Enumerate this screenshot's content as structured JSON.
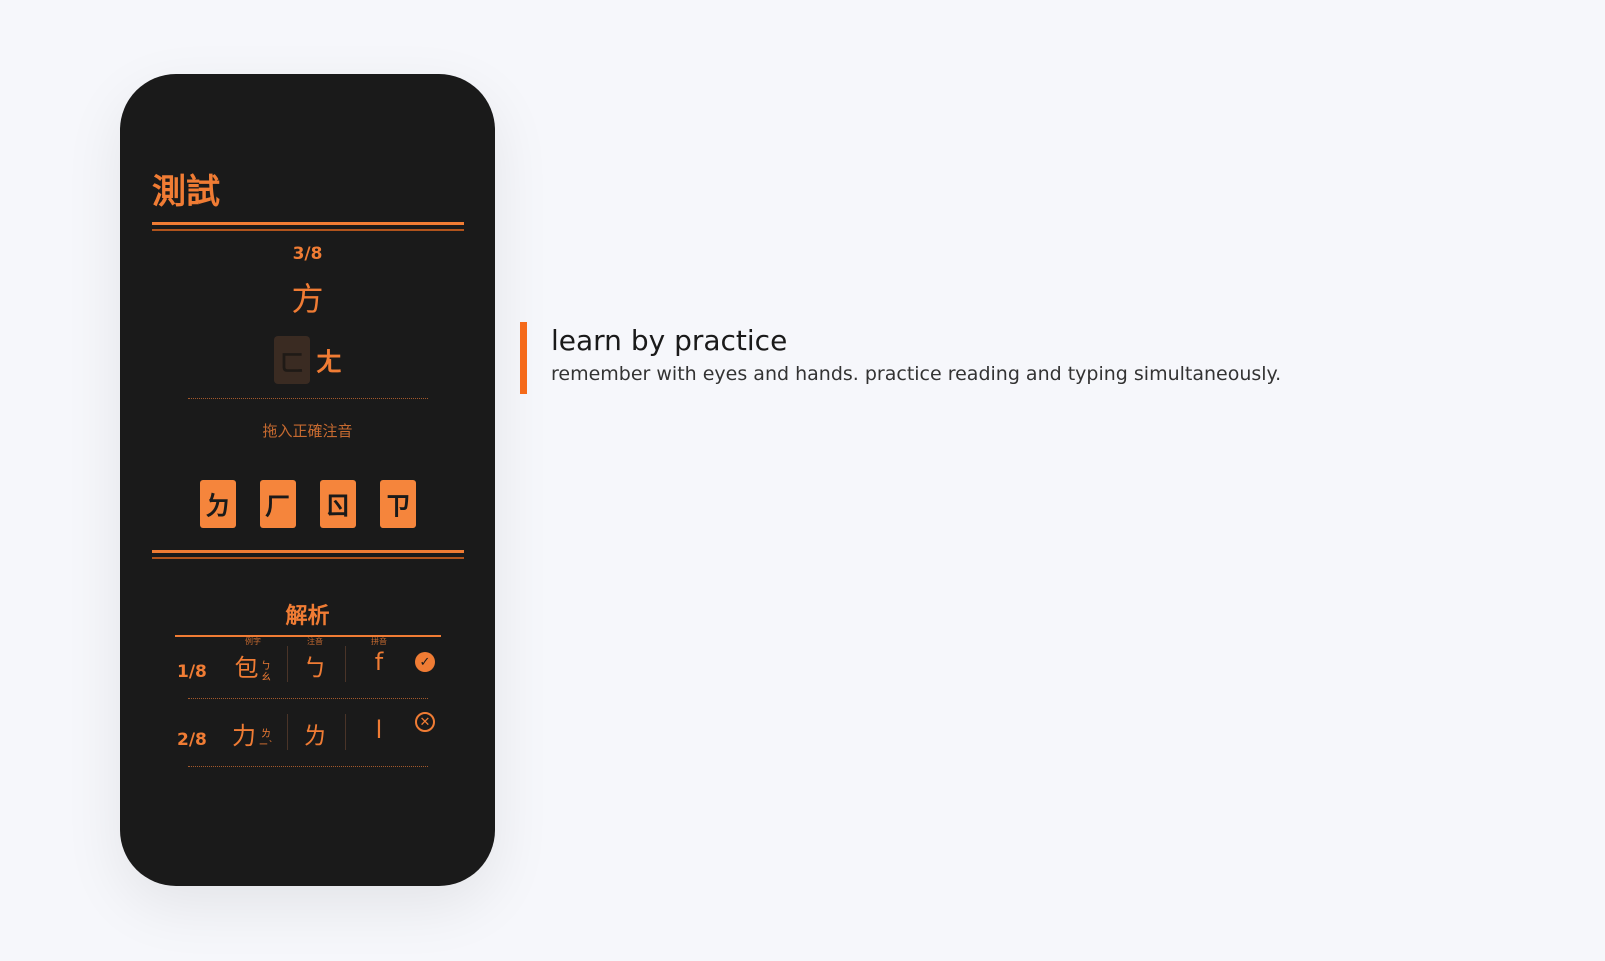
{
  "quiz": {
    "title": "測試",
    "progress": "3/8",
    "character": "方",
    "answer_slot": "ㄈ",
    "answer_filled": "ㄤ",
    "hint": "拖入正確注音",
    "options": [
      "ㄉ",
      "ㄏ",
      "ㄖ",
      "ㄗ"
    ]
  },
  "analysis": {
    "title": "解析",
    "headers": [
      "例字",
      "注音",
      "拼音"
    ],
    "rows": [
      {
        "num": "1/8",
        "example": "包",
        "example_zhuyin": "ㄅㄠ",
        "zhuyin": "ㄅ",
        "pinyin": "f",
        "status": "correct",
        "icon": "check-circle-icon"
      },
      {
        "num": "2/8",
        "example": "力",
        "example_zhuyin": "ㄌㄧˋ",
        "zhuyin": "ㄌ",
        "pinyin": "l",
        "status": "wrong",
        "icon": "x-circle-icon"
      }
    ]
  },
  "feature": {
    "title": "learn by practice",
    "description": "remember with eyes and hands. practice reading and typing simultaneously."
  },
  "colors": {
    "accent": "#f07c34",
    "phone_bg": "#1a1a1a",
    "bar": "#f56a1a"
  }
}
